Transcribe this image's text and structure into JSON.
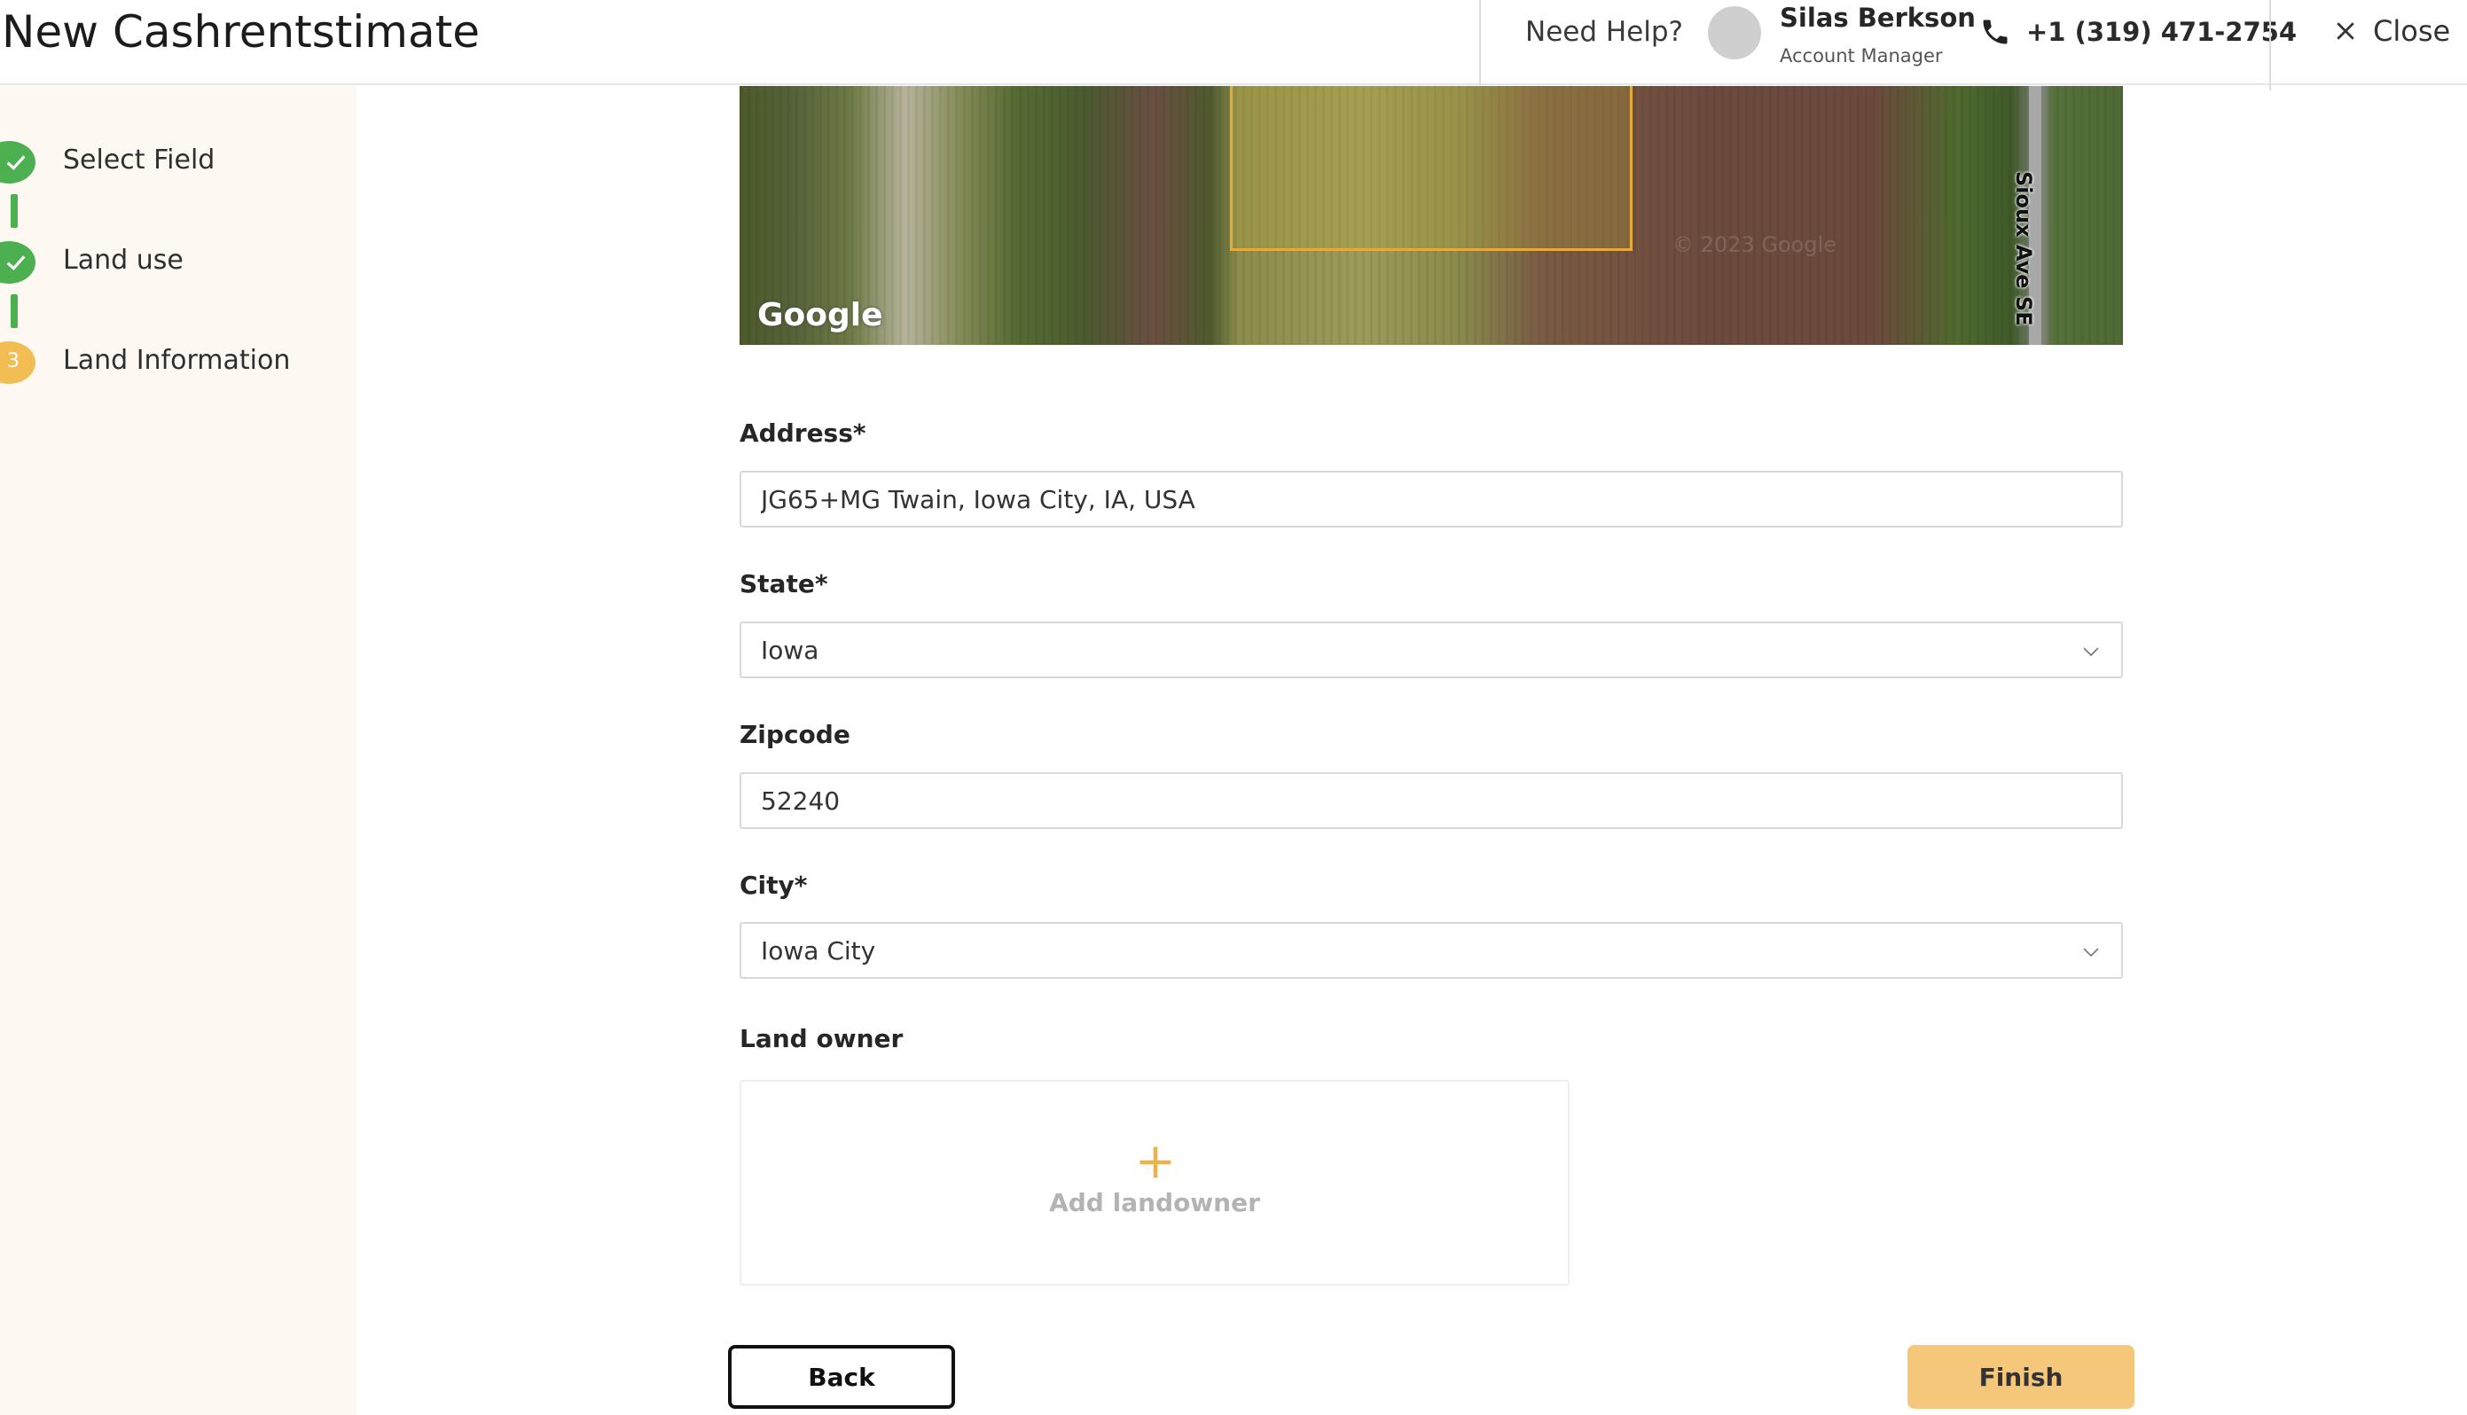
{
  "header": {
    "title": "New Cashrentstimate",
    "need_help": "Need Help?",
    "manager_name": "Silas Berkson",
    "manager_role": "Account Manager",
    "phone": "+1 (319) 471-2754",
    "close_label": "Close"
  },
  "steps": [
    {
      "label": "Select Field",
      "status": "done"
    },
    {
      "label": "Land use",
      "status": "done"
    },
    {
      "label": "Land Information",
      "status": "active",
      "number": "3"
    }
  ],
  "map": {
    "provider": "Google",
    "road_label": "Sioux Ave SE",
    "watermark": "© 2023 Google"
  },
  "form": {
    "address_label": "Address",
    "address_value": "JG65+MG Twain, Iowa City, IA, USA",
    "state_label": "State",
    "state_value": "Iowa",
    "zipcode_label": "Zipcode",
    "zipcode_value": "52240",
    "city_label": "City",
    "city_value": "Iowa City",
    "required_mark": "*",
    "landowner_label": "Land owner",
    "add_landowner": "Add landowner"
  },
  "actions": {
    "back": "Back",
    "finish": "Finish"
  },
  "colors": {
    "step_done": "#4caf50",
    "step_active": "#f2bd52",
    "finish_button": "#f4c77b",
    "sidebar_bg": "#fdf8f1"
  }
}
